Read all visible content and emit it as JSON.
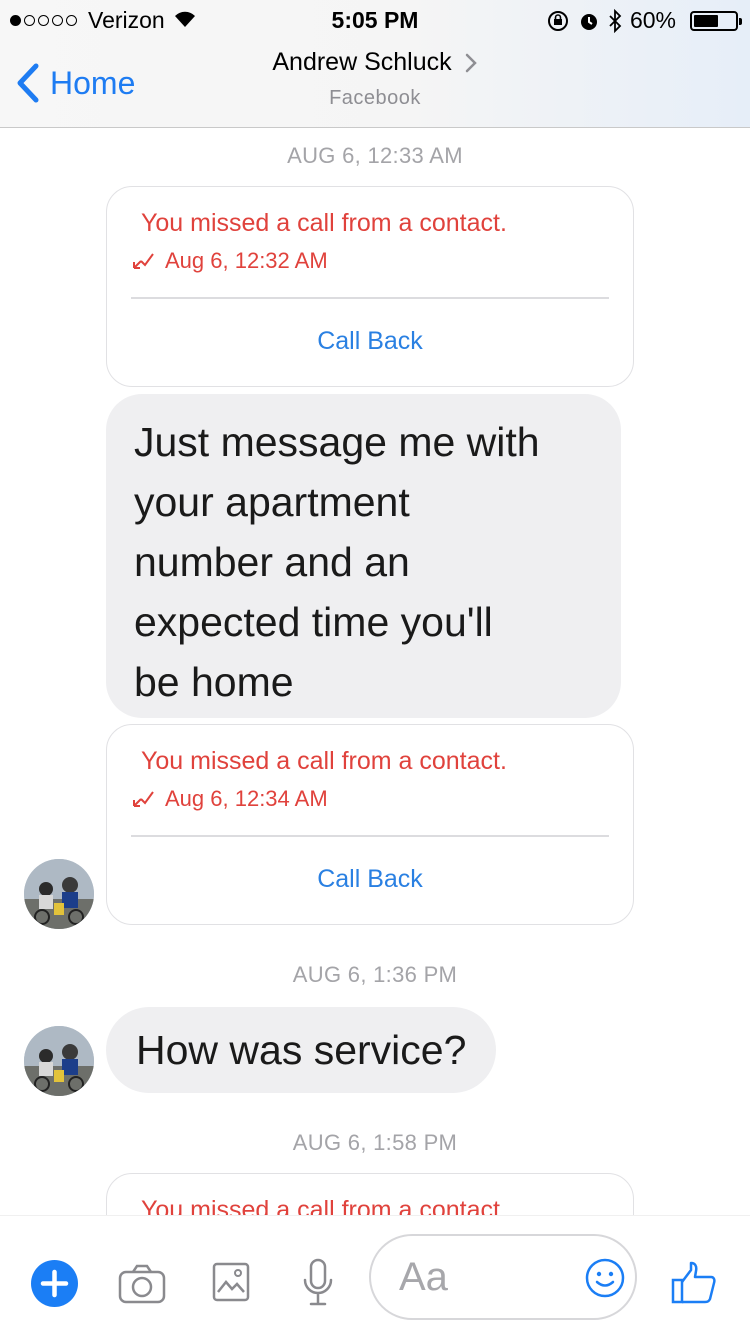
{
  "status_bar": {
    "carrier": "Verizon",
    "time": "5:05 PM",
    "battery_text": "60%",
    "battery_level": 0.6,
    "signal_bars": 1
  },
  "header": {
    "back_label": "Home",
    "contact_name": "Andrew Schluck",
    "subtitle": "Facebook"
  },
  "messages": {
    "timestamp_1": "AUG 6, 12:33 AM",
    "missed_call_1": {
      "title": "You missed a call from a contact.",
      "time": "Aug 6, 12:32 AM",
      "action": "Call Back"
    },
    "bubble_1": {
      "lines": [
        "Just message me with",
        "your apartment",
        "number and an",
        "expected time you'll",
        "be home"
      ]
    },
    "missed_call_2": {
      "title": "You missed a call from a contact.",
      "time": "Aug 6, 12:34 AM",
      "action": "Call Back"
    },
    "timestamp_2": "AUG 6, 1:36 PM",
    "bubble_2": {
      "text": "How was service?"
    },
    "timestamp_3": "AUG 6, 1:58 PM",
    "missed_call_3": {
      "title": "You missed a call from a contact."
    }
  },
  "composer": {
    "placeholder": "Aa"
  },
  "colors": {
    "accent_blue": "#1e7cf2",
    "missed_red": "#e0423c",
    "bubble_gray": "#efeff1",
    "timestamp_gray": "#a4a4a8"
  },
  "icons": [
    "wifi-icon",
    "rotation-lock-icon",
    "alarm-icon",
    "bluetooth-icon",
    "battery-icon",
    "back-chevron-icon",
    "chevron-right-icon",
    "missed-call-arrow-icon",
    "plus-icon",
    "camera-icon",
    "image-icon",
    "microphone-icon",
    "emoji-icon",
    "thumbs-up-icon"
  ]
}
